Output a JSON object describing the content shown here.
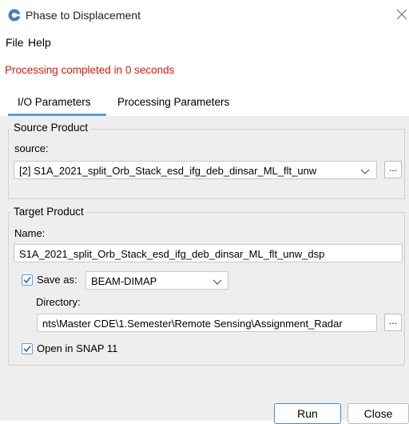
{
  "window": {
    "title": "Phase to Displacement",
    "close_icon": "close-icon",
    "app_icon": "snap-app-icon"
  },
  "menu": {
    "items": [
      "File",
      "Help"
    ]
  },
  "status": {
    "text": "Processing completed in 0 seconds",
    "color": "#e0180b"
  },
  "tabs": [
    {
      "label": "I/O Parameters",
      "selected": true
    },
    {
      "label": "Processing Parameters",
      "selected": false
    }
  ],
  "source_product": {
    "group_title": "Source Product",
    "label": "source:",
    "value": "[2] S1A_2021_split_Orb_Stack_esd_ifg_deb_dinsar_ML_flt_unw",
    "browse_label": "..."
  },
  "target_product": {
    "group_title": "Target Product",
    "name_label": "Name:",
    "name_value": "S1A_2021_split_Orb_Stack_esd_ifg_deb_dinsar_ML_flt_unw_dsp",
    "save_as_label": "Save as:",
    "save_as_checked": true,
    "format_value": "BEAM-DIMAP",
    "directory_label": "Directory:",
    "directory_value": "nts\\Master CDE\\1.Semester\\Remote Sensing\\Assignment_Radar",
    "browse_label": "...",
    "open_in_snap_label": "Open in SNAP 11",
    "open_in_snap_checked": true
  },
  "buttons": {
    "run": "Run",
    "close": "Close"
  },
  "colors": {
    "accent": "#5aa0e0",
    "panel_bg": "#eeeeee"
  }
}
